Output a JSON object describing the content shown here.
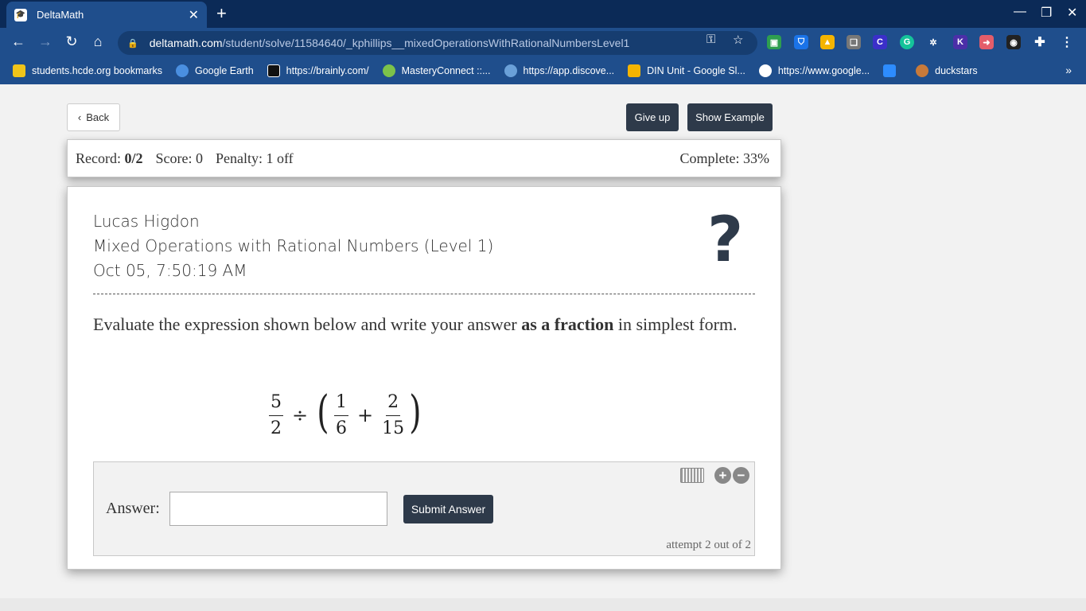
{
  "browser": {
    "tab_title": "DeltaMath",
    "tab_favicon": "graduation-cap",
    "new_tab": "+",
    "url_host": "deltamath.com",
    "url_path": "/student/solve/11584640/_kphillips__mixedOperationsWithRationalNumbersLevel1",
    "bookmarks": [
      {
        "label": "students.hcde.org bookmarks",
        "color": "#f0c419"
      },
      {
        "label": "Google Earth",
        "color": "#4a8fe0"
      },
      {
        "label": "https://brainly.com/",
        "color": "#111111"
      },
      {
        "label": "MasteryConnect ::...",
        "color": "#7cc24a"
      },
      {
        "label": "https://app.discove...",
        "color": "#6aa0d8"
      },
      {
        "label": "DIN Unit - Google Sl...",
        "color": "#f4b400"
      },
      {
        "label": "https://www.google...",
        "color": "#ffffff"
      },
      {
        "label": "",
        "color": "#2d8cff"
      },
      {
        "label": "duckstars",
        "color": "#c87a3a"
      }
    ],
    "bookmarks_more": "»"
  },
  "page": {
    "back_label": "Back",
    "give_up_label": "Give up",
    "show_example_label": "Show Example"
  },
  "status": {
    "record_label": "Record:",
    "record_value": "0/2",
    "score": "Score: 0",
    "penalty": "Penalty: 1 off",
    "complete": "Complete: 33%"
  },
  "problem": {
    "student_name": "Lucas Higdon",
    "assignment": "Mixed Operations with Rational Numbers (Level 1)",
    "timestamp": "Oct 05, 7:50:19 AM",
    "help_icon": "?",
    "prompt_before": "Evaluate the expression shown below and write your answer ",
    "prompt_bold": "as a fraction",
    "prompt_after": " in simplest form.",
    "expression": {
      "f1_num": "5",
      "f1_den": "2",
      "op1": "÷",
      "open_paren": "(",
      "f2_num": "1",
      "f2_den": "6",
      "op2": "+",
      "f3_num": "2",
      "f3_den": "15",
      "close_paren": ")"
    }
  },
  "answer": {
    "label": "Answer:",
    "value": "",
    "submit_label": "Submit Answer",
    "attempt_text": "attempt 2 out of 2",
    "plus": "+",
    "minus": "−"
  }
}
